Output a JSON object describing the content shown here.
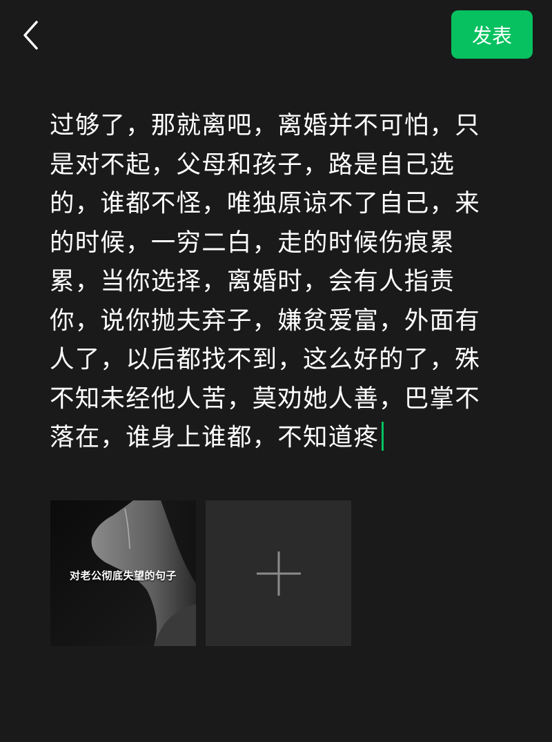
{
  "header": {
    "back_icon": "chevron-left-icon",
    "publish_label": "发表",
    "accent_color": "#07c160"
  },
  "post": {
    "text": "过够了，那就离吧，离婚并不可怕，只是对不起，父母和孩子，路是自己选的，谁都不怪，唯独原谅不了自己，来的时候，一穷二白，走的时候伤痕累累，当你选择，离婚时，会有人指责你，说你抛夫弃子，嫌贫爱富，外面有人了，以后都找不到，这么好的了，殊不知未经他人苦，莫劝她人善，巴掌不落在，谁身上谁都，不知道疼"
  },
  "media": {
    "thumbnails": [
      {
        "caption": "对老公彻底失望的句子"
      }
    ],
    "add_icon": "plus-icon"
  }
}
